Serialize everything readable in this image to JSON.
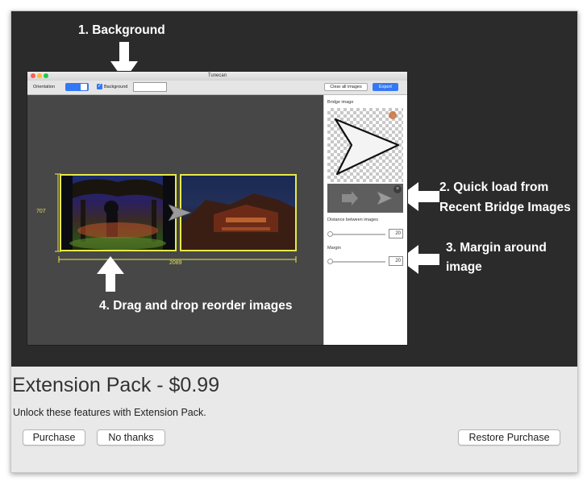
{
  "callouts": {
    "background": "1. Background",
    "quick_load_line1": "2. Quick load from",
    "quick_load_line2": "Recent Bridge Images",
    "margin_line1": "3. Margin around",
    "margin_line2": "image",
    "drag_drop": "4. Drag and drop reorder images"
  },
  "app_window": {
    "title": "Tunecan",
    "toolbar": {
      "orientation_label": "Orientation",
      "background_label": "Background",
      "background_checked": true,
      "clear_button": "Clear all images",
      "export_button": "Export"
    },
    "canvas": {
      "height_label": "707",
      "width_label": "2089"
    },
    "sidebar": {
      "bridge_image_label": "Bridge image",
      "distance_label": "Distance between images",
      "distance_value": "20",
      "margin_label": "Margin",
      "margin_value": "20"
    }
  },
  "purchase_panel": {
    "title": "Extension Pack - $0.99",
    "subtitle": "Unlock these features with Extension Pack.",
    "purchase_button": "Purchase",
    "no_thanks_button": "No thanks",
    "restore_button": "Restore Purchase"
  },
  "colors": {
    "dark_background": "#2b2b2b",
    "panel_background": "#e9e9e9",
    "guide_yellow": "#e7e94a",
    "export_blue": "#3478f6"
  },
  "icons": [
    "down-arrow-icon",
    "left-arrow-icon",
    "up-arrow-icon",
    "bridge-arrow-icon",
    "close-icon"
  ]
}
